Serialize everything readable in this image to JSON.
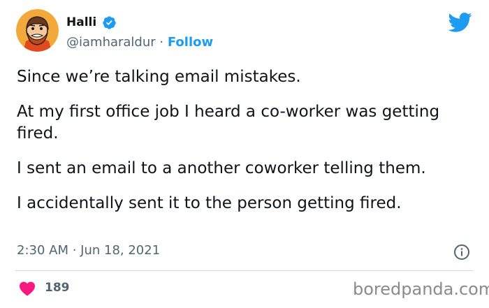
{
  "tweet": {
    "author": {
      "name": "Halli",
      "handle": "@iamharaldur",
      "separator": " · ",
      "follow_label": "Follow"
    },
    "text": [
      "Since we’re talking email mistakes.",
      "At my first office job I heard a co-worker was getting fired.",
      "I sent an email to a another coworker telling them.",
      "I accidentally sent it to the person getting fired."
    ],
    "timestamp": "2:30 AM · Jun 18, 2021",
    "likes": "189"
  },
  "watermark": "boredpanda.com",
  "colors": {
    "accent": "#1d9bf0",
    "like": "#f91880",
    "secondary_text": "#536471",
    "divider": "#cfd9de",
    "avatar_bg": "#f2a83b"
  },
  "icons": [
    "verified-badge-icon",
    "twitter-bird-icon",
    "info-icon",
    "heart-icon"
  ]
}
